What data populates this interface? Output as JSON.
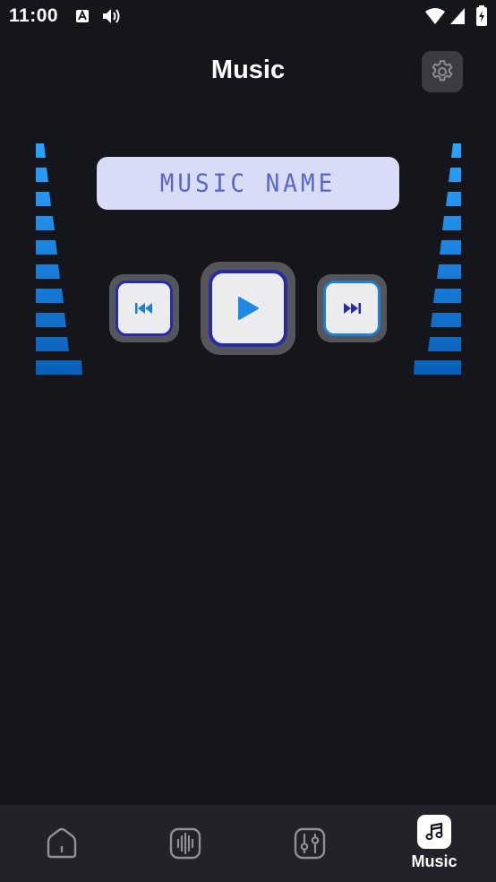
{
  "status_bar": {
    "time": "11:00",
    "icons": [
      "keyboard-a-icon",
      "volume-icon",
      "wifi-icon",
      "signal-icon",
      "battery-icon"
    ]
  },
  "header": {
    "title": "Music",
    "settings_icon": "gear-icon"
  },
  "player": {
    "track_name": "MUSIC NAME",
    "buttons": [
      "previous",
      "play",
      "next"
    ]
  },
  "colors": {
    "background": "#15161b",
    "accent_blue": "#1e88e5",
    "lcd_background": "#d8dcf6",
    "lcd_text": "#5a66cc",
    "nav_background": "#222329"
  },
  "bottom_nav": {
    "items": [
      {
        "id": "home",
        "icon": "home-icon",
        "label": ""
      },
      {
        "id": "sound",
        "icon": "waveform-icon",
        "label": ""
      },
      {
        "id": "equalizer",
        "icon": "sliders-icon",
        "label": ""
      },
      {
        "id": "music",
        "icon": "music-note-icon",
        "label": "Music"
      }
    ],
    "active": "music"
  }
}
